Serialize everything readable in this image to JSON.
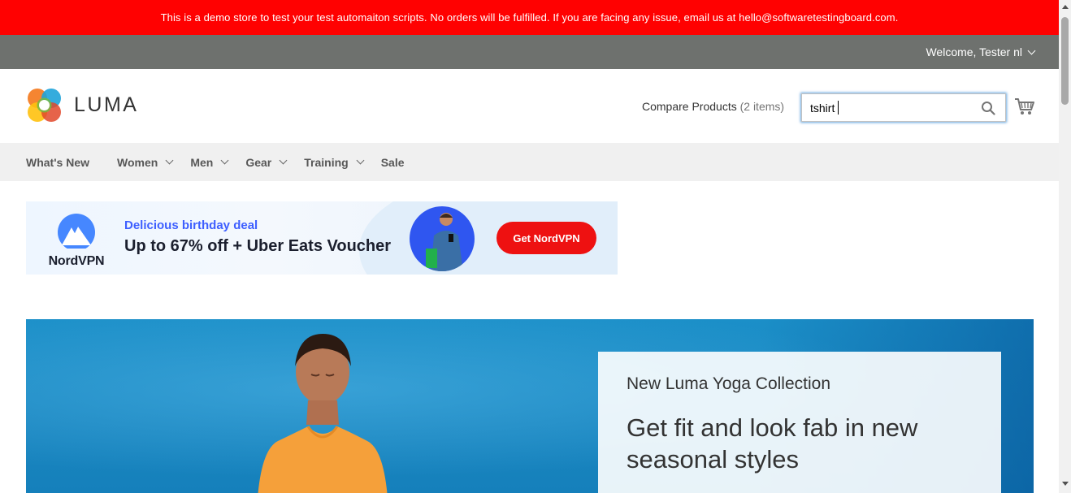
{
  "demo_notice": {
    "text": "This is a demo store to test your test automaiton scripts. No orders will be fulfilled. If you are facing any issue, email us at hello@softwaretestingboard.com."
  },
  "panel": {
    "welcome": "Welcome, Tester nl"
  },
  "header": {
    "logo_text": "LUMA",
    "compare_label": "Compare Products",
    "compare_count": "(2 items)",
    "search_value": "tshirt",
    "search_icon": "search-icon",
    "cart_icon": "cart-icon"
  },
  "nav": {
    "items": [
      {
        "label": "What's New",
        "has_submenu": false
      },
      {
        "label": "Women",
        "has_submenu": true
      },
      {
        "label": "Men",
        "has_submenu": true
      },
      {
        "label": "Gear",
        "has_submenu": true
      },
      {
        "label": "Training",
        "has_submenu": true
      },
      {
        "label": "Sale",
        "has_submenu": false
      }
    ]
  },
  "ad": {
    "brand": "NordVPN",
    "line1": "Delicious birthday deal",
    "line2": "Up to 67% off + Uber Eats Voucher",
    "button": "Get NordVPN"
  },
  "hero": {
    "subtitle": "New Luma Yoga Collection",
    "title": "Get fit and look fab in new seasonal styles"
  },
  "colors": {
    "notice_bg": "#ff0101",
    "panel_bg": "#6e716e",
    "nav_bg": "#f0f0f0",
    "search_focus": "#68a8e0",
    "ad_button": "#ee1111"
  }
}
